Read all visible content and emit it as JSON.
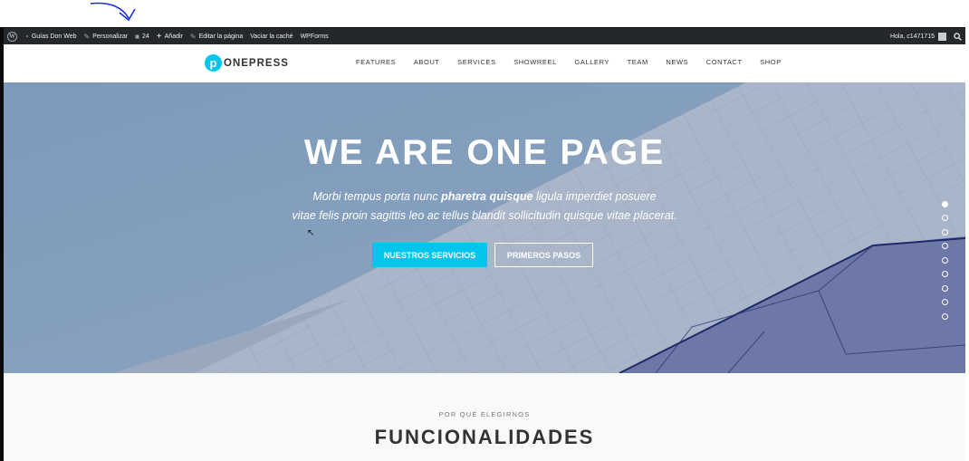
{
  "adminbar": {
    "items": [
      "Guías Don Web",
      "Personalizar",
      "24",
      "Añadir",
      "Editar la página",
      "Vaciar la caché",
      "WPForms"
    ],
    "greeting": "Hola, c1471715"
  },
  "site": {
    "logo_letter": "p",
    "logo_text": "ONEPRESS",
    "nav": [
      "FEATURES",
      "ABOUT",
      "SERVICES",
      "SHOWREEL",
      "GALLERY",
      "TEAM",
      "NEWS",
      "CONTACT",
      "SHOP"
    ]
  },
  "hero": {
    "title": "WE ARE ONE PAGE",
    "sub_line1_pre": "Morbi tempus porta nunc ",
    "sub_line1_bold": "pharetra quisque",
    "sub_line1_post": " ligula imperdiet posuere",
    "sub_line2": "vitae felis proin sagittis leo ac tellus blandit sollicitudin quisque vitae placerat.",
    "primary_button": "NUESTROS SERVICIOS",
    "secondary_button": "PRIMEROS PASOS",
    "slide_count": 9,
    "active_slide": 1
  },
  "features": {
    "eyebrow": "POR QUÉ ELEGIRNOS",
    "title": "FUNCIONALIDADES"
  },
  "colors": {
    "accent": "#03c4eb",
    "adminbar": "#23282d",
    "annotation": "#1a2fd6"
  }
}
